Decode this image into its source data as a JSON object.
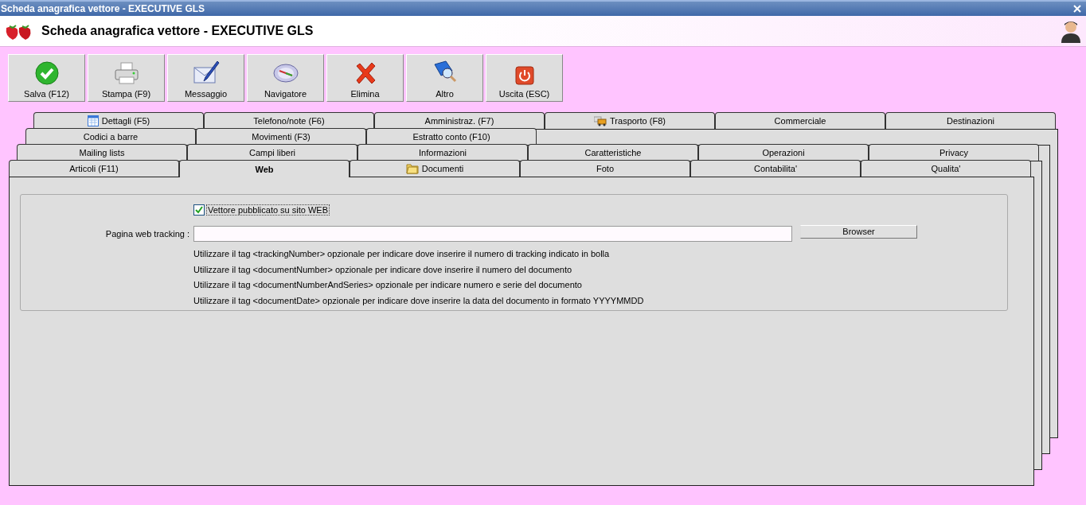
{
  "window": {
    "title": "Scheda anagrafica vettore - EXECUTIVE GLS"
  },
  "header": {
    "title": "Scheda anagrafica vettore - EXECUTIVE GLS"
  },
  "toolbar": [
    {
      "label": "Salva (F12)",
      "kind": "save"
    },
    {
      "label": "Stampa (F9)",
      "kind": "print"
    },
    {
      "label": "Messaggio",
      "kind": "message"
    },
    {
      "label": "Navigatore",
      "kind": "compass"
    },
    {
      "label": "Elimina",
      "kind": "delete"
    },
    {
      "label": "Altro",
      "kind": "more"
    },
    {
      "label": "Uscita (ESC)",
      "kind": "exit"
    }
  ],
  "tab_rows": [
    [
      {
        "label": "Dettagli (F5)",
        "kind": "calendar",
        "selected": false
      },
      {
        "label": "Telefono/note (F6)",
        "kind": "plain",
        "selected": false
      },
      {
        "label": "Amministraz. (F7)",
        "kind": "plain",
        "selected": false
      },
      {
        "label": "Trasporto (F8)",
        "kind": "truck",
        "selected": false
      },
      {
        "label": "Commerciale",
        "kind": "plain",
        "selected": false
      },
      {
        "label": "Destinazioni",
        "kind": "plain",
        "selected": false
      }
    ],
    [
      {
        "label": "Codici a barre",
        "kind": "plain",
        "selected": false
      },
      {
        "label": "Movimenti (F3)",
        "kind": "plain",
        "selected": false
      },
      {
        "label": "Estratto conto (F10)",
        "kind": "plain",
        "selected": false
      }
    ],
    [
      {
        "label": "Mailing lists",
        "kind": "plain",
        "selected": false
      },
      {
        "label": "Campi liberi",
        "kind": "plain",
        "selected": false
      },
      {
        "label": "Informazioni",
        "kind": "plain",
        "selected": false
      },
      {
        "label": "Caratteristiche",
        "kind": "plain",
        "selected": false
      },
      {
        "label": "Operazioni",
        "kind": "plain",
        "selected": false
      },
      {
        "label": "Privacy",
        "kind": "plain",
        "selected": false
      }
    ],
    [
      {
        "label": "Articoli (F11)",
        "kind": "plain",
        "selected": false
      },
      {
        "label": "Web",
        "kind": "plain",
        "selected": true
      },
      {
        "label": "Documenti",
        "kind": "folder",
        "selected": false
      },
      {
        "label": "Foto",
        "kind": "plain",
        "selected": false
      },
      {
        "label": "Contabilita'",
        "kind": "plain",
        "selected": false
      },
      {
        "label": "Qualita'",
        "kind": "plain",
        "selected": false
      }
    ]
  ],
  "web": {
    "checkbox": {
      "label": "Vettore pubblicato su sito WEB",
      "checked": true
    },
    "field": {
      "label": "Pagina web tracking :"
    },
    "button": "Browser",
    "help_lines": [
      "Utilizzare il tag <trackingNumber> opzionale per indicare dove inserire il numero di tracking indicato in bolla",
      "Utilizzare il tag <documentNumber> opzionale per indicare dove inserire il numero del documento",
      "Utilizzare il tag <documentNumberAndSeries> opzionale per indicare numero e serie del documento",
      "Utilizzare il tag <documentDate> opzionale per indicare dove inserire la data del documento in formato YYYYMMDD"
    ]
  }
}
